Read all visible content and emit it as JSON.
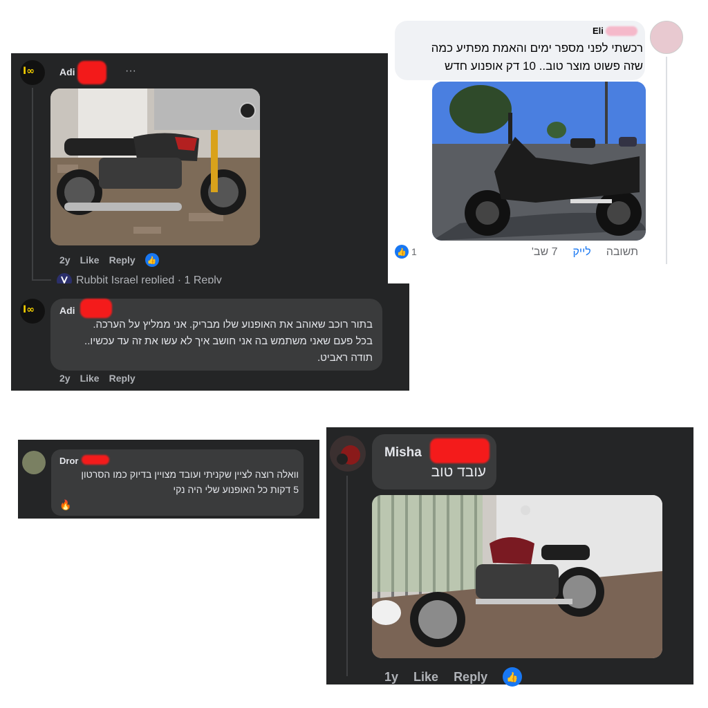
{
  "comment_adi_1": {
    "author": "Adi",
    "more": "···",
    "age": "2y",
    "like": "Like",
    "reply": "Reply",
    "replied_text": "Rubbit Israel replied · 1 Reply"
  },
  "comment_adi_2": {
    "author": "Adi",
    "line1": "בתור רוכב שאוהב את האופנוע שלו מבריק. אני ממליץ על הערכה.",
    "line2": "בכל פעם שאני משתמש בה אני חושב איך לא עשו את זה עד עכשיו..",
    "line3": "תודה ראביט.",
    "age": "2y",
    "like": "Like",
    "reply": "Reply"
  },
  "comment_eli": {
    "author": "Eli",
    "line1": "רכשתי לפני מספר ימים והאמת מפתיע כמה",
    "line2": "שזה פשוט מוצר טוב.. 10 דק אופנוע חדש",
    "reaction_count": "1",
    "reply": "תשובה",
    "like": "לייק",
    "age": "7 שב'"
  },
  "comment_dror": {
    "author": "Dror",
    "line1": "וואלה רוצה לציין שקניתי ועובד מצויין בדיוק כמו הסרטון",
    "line2": "5 דקות כל האופנוע שלי היה נקי",
    "emoji": "🔥"
  },
  "comment_misha": {
    "author": "Misha",
    "text": "עובד טוב",
    "age": "1y",
    "like": "Like",
    "reply": "Reply"
  },
  "colors": {
    "dark_bg": "#242526",
    "bubble_dark": "#3a3b3c",
    "like_blue": "#1877f2",
    "redaction": "#ff1a1a"
  }
}
